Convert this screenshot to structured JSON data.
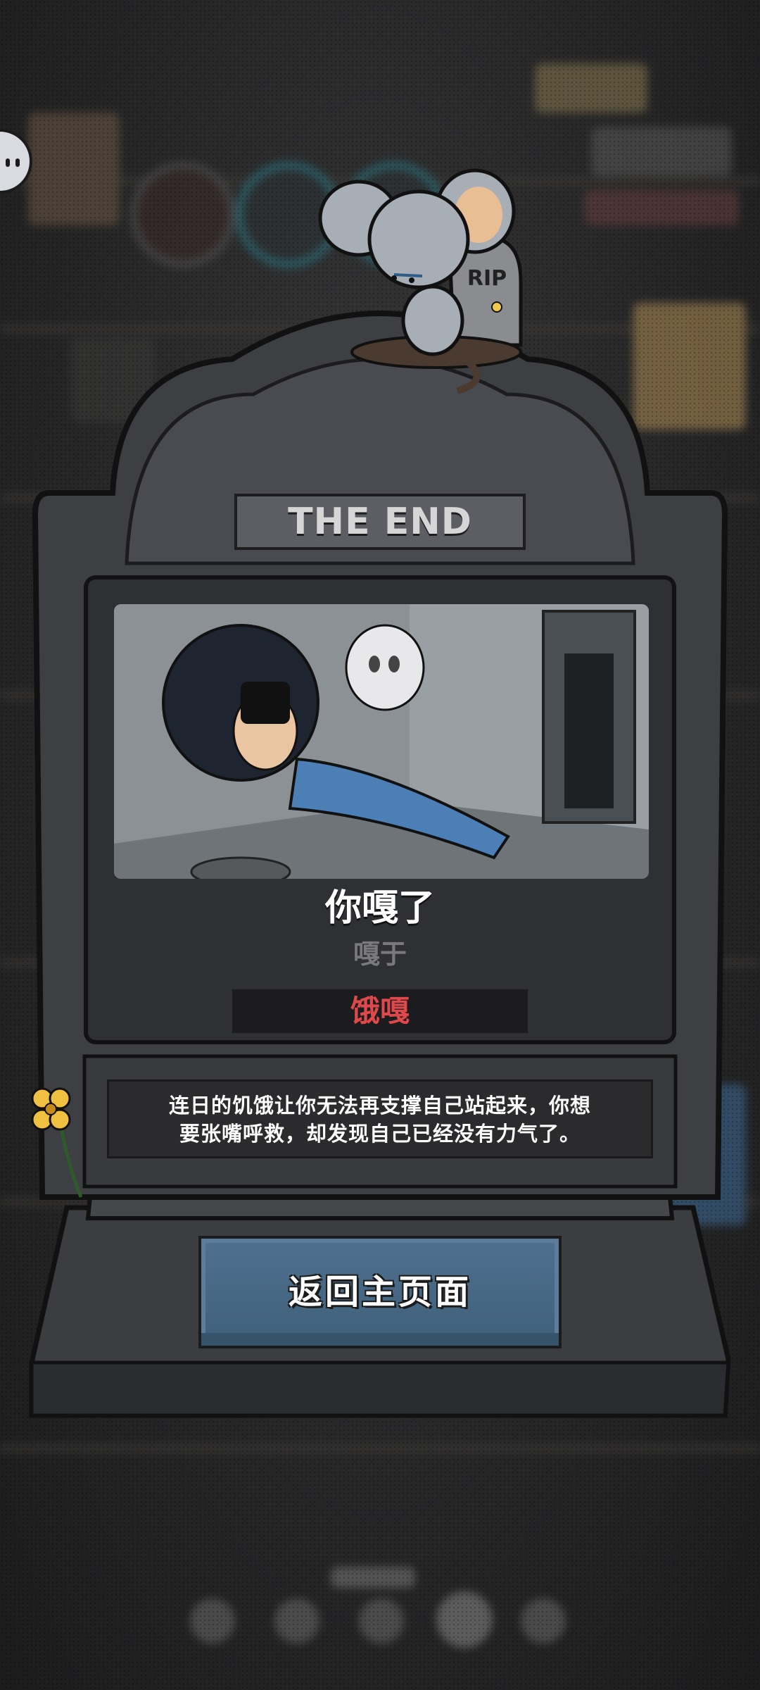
{
  "tombstone": {
    "header": "THE END",
    "rip_text": "RIP"
  },
  "result": {
    "title": "你嘎了",
    "subtitle": "嘎于",
    "cause": "饿嘎",
    "description_line1": "连日的饥饿让你无法再支撑自己站起来，你想",
    "description_line2": "要张嘴呼救，却发现自己已经没有力气了。"
  },
  "actions": {
    "home_label": "返回主页面"
  },
  "colors": {
    "cause_text": "#e0494b",
    "button_blue": "#4f7090",
    "stone": "#3a3b3f"
  }
}
